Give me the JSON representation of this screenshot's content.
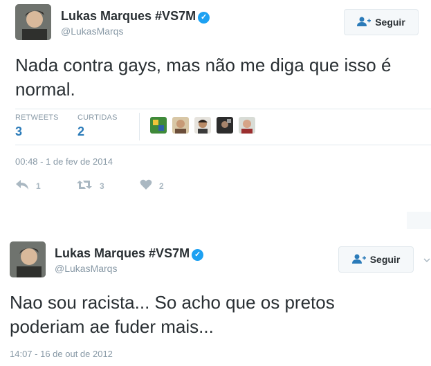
{
  "tweet1": {
    "author_name": "Lukas Marques #VS7M",
    "author_handle": "@LukasMarqs",
    "follow_label": "Seguir",
    "text": "Nada contra gays, mas não me diga que isso é normal.",
    "retweets_label": "RETWEETS",
    "retweets_count": "3",
    "likes_label": "CURTIDAS",
    "likes_count": "2",
    "timestamp": "00:48 - 1 de fev de 2014",
    "reply_count": "1",
    "retweet_action_count": "3",
    "like_action_count": "2"
  },
  "tweet2": {
    "author_name": "Lukas Marques #VS7M",
    "author_handle": "@LukasMarqs",
    "follow_label": "Seguir",
    "text": "Nao sou racista... So acho que os pretos poderiam ae fuder mais...",
    "timestamp": "14:07 - 16 de out de 2012"
  },
  "icons": {
    "verified": "verified-badge-icon",
    "follow": "add-user-icon",
    "reply": "reply-icon",
    "retweet": "retweet-icon",
    "like": "heart-icon",
    "more": "chevron-down-icon"
  },
  "colors": {
    "accent": "#2b7bb9",
    "verified": "#1da1f2",
    "muted": "#8899a6",
    "action": "#aab8c2"
  }
}
